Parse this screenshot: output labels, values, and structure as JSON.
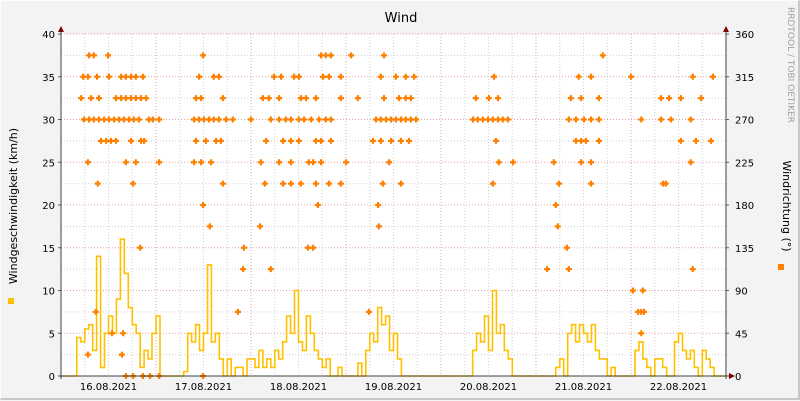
{
  "chart_data": {
    "type": "line",
    "title": "Wind",
    "watermark": "RRDTOOL / TOBI OETIKER",
    "ylabel": "Windgeschwindigkeit (km/h)",
    "y2label": "Windrichtung (°)",
    "ylim": [
      0,
      40
    ],
    "y2lim": [
      0,
      360
    ],
    "yticks": [
      "0",
      "5",
      "10",
      "15",
      "20",
      "25",
      "30",
      "35",
      "40"
    ],
    "y2ticks": [
      "0",
      "45",
      "90",
      "135",
      "180",
      "225",
      "270",
      "315",
      "360"
    ],
    "xlabels": [
      "16.08.2021",
      "17.08.2021",
      "18.08.2021",
      "19.08.2021",
      "20.08.2021",
      "21.08.2021",
      "22.08.2021"
    ],
    "x_range_hours": [
      0,
      168
    ],
    "grid": true,
    "colors": {
      "speed": "#ffc000",
      "direction": "#ff8000",
      "major_grid": "#e0a0a0",
      "minor_grid": "#d0d0d0",
      "axis": "#800000"
    },
    "series": [
      {
        "name": "Windgeschwindigkeit",
        "axis": "left",
        "style": "step",
        "hourly_values": [
          0,
          0,
          0,
          0,
          4.5,
          4,
          5.5,
          6,
          3,
          14,
          1,
          5,
          7,
          5,
          9,
          16,
          12,
          8,
          6,
          5,
          1,
          3,
          2,
          5,
          7,
          0,
          0,
          0,
          0,
          0,
          0,
          0.5,
          5,
          4,
          6,
          3,
          5,
          13,
          4,
          5,
          2,
          0,
          2,
          0,
          1,
          1,
          0,
          2,
          2,
          1,
          3,
          1,
          2,
          1,
          3,
          2,
          4,
          7,
          5,
          10,
          4,
          3,
          7,
          5,
          3,
          2,
          1,
          2,
          0,
          0,
          1,
          0,
          0,
          0,
          0,
          1.5,
          0,
          3,
          5,
          4,
          8,
          6,
          7,
          3,
          5,
          2,
          0,
          0,
          0,
          0,
          0,
          0,
          0,
          0,
          0,
          0,
          0,
          0,
          0,
          0,
          0,
          0,
          0,
          0,
          3,
          5,
          4,
          7,
          3,
          10,
          5,
          6,
          3,
          2,
          0,
          0,
          0,
          0,
          0,
          0,
          0,
          0,
          0,
          0,
          0,
          1,
          2,
          0,
          5,
          6,
          4,
          6,
          5,
          4,
          6,
          3,
          2,
          2,
          0,
          1,
          0,
          0,
          0,
          0,
          0,
          3,
          4,
          2,
          1,
          0,
          2,
          2,
          1,
          0,
          0,
          4,
          5,
          3,
          2,
          3,
          1,
          0,
          3,
          2,
          1,
          0,
          0,
          0
        ]
      },
      {
        "name": "Windrichtung",
        "axis": "right",
        "style": "points",
        "points_by_degree": {
          "337.5": [
            7.1,
            8.3,
            11.9,
            35.9,
            65.7,
            66.9,
            68.2,
            73.3,
            81.6,
            136.9
          ],
          "315": [
            5.6,
            6.8,
            9.1,
            12.1,
            15.2,
            16.4,
            17.7,
            18.9,
            20.7,
            34.9,
            38.6,
            39.9,
            53.8,
            55.6,
            58.9,
            60.1,
            66.2,
            67.7,
            70.7,
            80.8,
            84.6,
            87.1,
            89.2,
            109.4,
            130.8,
            133.9,
            144,
            159.6,
            164.7
          ],
          "292.5": [
            5.1,
            7.6,
            9.6,
            13.9,
            15.2,
            16.4,
            17.7,
            18.9,
            20.2,
            21.5,
            34.1,
            35.4,
            40.9,
            51,
            52.5,
            55.1,
            60.6,
            61.9,
            64.4,
            70.7,
            75,
            81.6,
            85.4,
            87.1,
            88.4,
            104.8,
            108.1,
            110.4,
            128.8,
            131.4,
            135.9,
            151.6,
            153.6,
            156.6,
            161.7
          ],
          "270": [
            5.8,
            7.1,
            8.3,
            9.6,
            10.9,
            12.1,
            13.4,
            14.7,
            15.9,
            17.2,
            18.4,
            19.7,
            22.2,
            23.2,
            24.8,
            33.6,
            34.9,
            36.1,
            37.4,
            38.6,
            39.9,
            41.7,
            43.4,
            48,
            53,
            55.1,
            56.8,
            58.1,
            60.1,
            61.4,
            63.2,
            65.2,
            66.9,
            68.2,
            79.6,
            80.8,
            82.1,
            83.4,
            84.6,
            85.9,
            87.1,
            88.4,
            89.7,
            104.1,
            105.3,
            106.6,
            107.9,
            109.1,
            110.4,
            111.6,
            112.9,
            128.3,
            130.1,
            132.1,
            133.9,
            135.9,
            146.6,
            151.6,
            154.1,
            159.1
          ],
          "247.5": [
            10.1,
            11.4,
            12.6,
            13.9,
            17.7,
            20.2,
            21,
            34.1,
            36.6,
            39.2,
            40.4,
            51.8,
            56.1,
            58.1,
            60.1,
            64.4,
            65.7,
            68.2,
            78.8,
            80.8,
            83.4,
            85.9,
            87.9,
            109.9,
            130.1,
            131.4,
            132.6,
            135.9,
            156.6,
            160.4,
            164.2
          ],
          "225": [
            6.8,
            16.4,
            18.9,
            24.8,
            33.6,
            35.4,
            37.9,
            50.5,
            55.1,
            58.1,
            62.6,
            63.7,
            65.7,
            72,
            82.9,
            110.6,
            114.2,
            124.5,
            131.4,
            133.9,
            159.1
          ],
          "202.5": [
            9.3,
            18.2,
            40.9,
            51.5,
            56.1,
            58.1,
            60.6,
            64.4,
            67.7,
            70.7,
            81.3,
            85.9,
            109.1,
            125.8,
            133.9,
            152.1,
            152.8
          ],
          "180": [
            35.9,
            64.9,
            80.1,
            125
          ],
          "157.5": [
            37.6,
            50.3,
            80.3,
            125.5
          ],
          "135": [
            20,
            46.2,
            62.4,
            63.7,
            127.8
          ],
          "112.5": [
            46,
            53,
            122.8,
            128.3,
            159.6
          ],
          "90": [
            144.5,
            147
          ],
          "67.5": [
            8.8,
            44.7,
            77.8,
            145.8,
            146.6,
            147.3
          ],
          "45": [
            12.9,
            15.7,
            146.6
          ],
          "22.5": [
            6.8,
            15.4
          ],
          "0": [
            16.4,
            18.2,
            20.7,
            22.5,
            24.8,
            35.9
          ]
        }
      }
    ],
    "legend": [
      {
        "series": "Windgeschwindigkeit",
        "placement": "left"
      },
      {
        "series": "Windrichtung",
        "placement": "right"
      }
    ]
  }
}
